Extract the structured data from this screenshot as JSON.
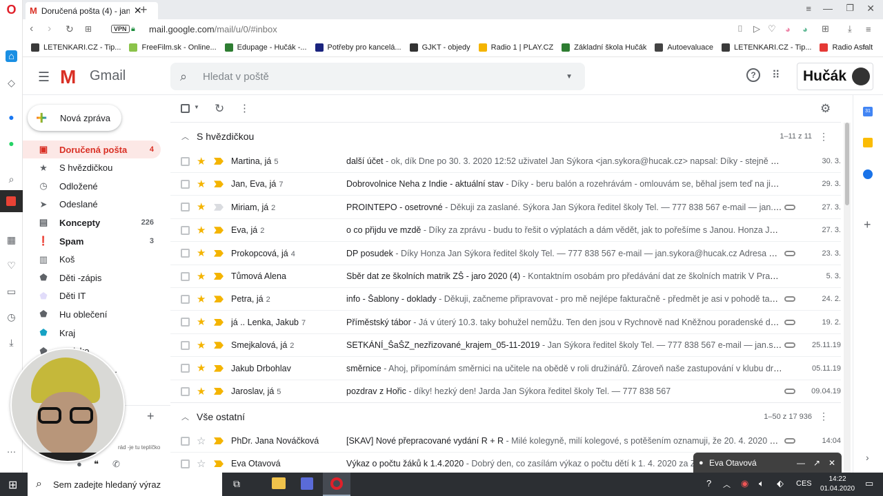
{
  "browser": {
    "tab_title": "Doručená pošta (4) - jan.sy",
    "url_domain": "mail.google.com",
    "url_path": "/mail/u/0/#inbox",
    "vpn_label": "VPN",
    "bookmarks": [
      {
        "label": "LETENKARI.CZ - Tip...",
        "color": "#3a3a3a"
      },
      {
        "label": "FreeFilm.sk - Online...",
        "color": "#8bc34a"
      },
      {
        "label": "Edupage - Hučák -...",
        "color": "#2e7d32"
      },
      {
        "label": "Potřeby pro kancelá...",
        "color": "#1a237e"
      },
      {
        "label": "GJKT - objedy",
        "color": "#333333"
      },
      {
        "label": "Radio 1 | PLAY.CZ",
        "color": "#f4b400"
      },
      {
        "label": "Základní škola Hučák",
        "color": "#2e7d32"
      },
      {
        "label": "Autoevaluace",
        "color": "#444444"
      },
      {
        "label": "LETENKARI.CZ - Tip...",
        "color": "#3a3a3a"
      },
      {
        "label": "Radio Asfalt",
        "color": "#e53935"
      }
    ]
  },
  "gmail": {
    "app_name": "Gmail",
    "search_placeholder": "Hledat v poště",
    "account_logo_text": "Hučák",
    "compose_label": "Nová zpráva",
    "nav": [
      {
        "label": "Doručená pošta",
        "count": "4",
        "icon": "inbox-icon",
        "active": true,
        "bold": true
      },
      {
        "label": "S hvězdičkou",
        "count": "",
        "icon": "star-icon"
      },
      {
        "label": "Odložené",
        "count": "",
        "icon": "clock-icon"
      },
      {
        "label": "Odeslané",
        "count": "",
        "icon": "send-icon"
      },
      {
        "label": "Koncepty",
        "count": "226",
        "icon": "draft-icon",
        "bold": true
      },
      {
        "label": "Spam",
        "count": "3",
        "icon": "spam-icon",
        "bold": true
      },
      {
        "label": "Koš",
        "count": "",
        "icon": "trash-icon"
      },
      {
        "label": "Děti -zápis",
        "count": "",
        "icon": "label-icon",
        "color": "#5f6368"
      },
      {
        "label": "Děti IT",
        "count": "",
        "icon": "label-icon",
        "color": "#e1dcfa"
      },
      {
        "label": "Hu oblečení",
        "count": "",
        "icon": "label-icon",
        "color": "#5f6368"
      },
      {
        "label": "Kraj",
        "count": "",
        "icon": "label-icon",
        "color": "#16a2c4"
      },
      {
        "label": "…alsko",
        "count": "",
        "icon": "label-icon",
        "color": "#5f6368"
      },
      {
        "label": "…chna věci …",
        "count": "",
        "icon": "label-icon",
        "color": "#5f6368"
      }
    ],
    "hangout_snippet": "rád -je tu teplíčko",
    "starred_section": {
      "title": "S hvězdičkou",
      "range": "1–11 z 11",
      "rows": [
        {
          "sender": "Martina, já",
          "count": "5",
          "subject": "další účet",
          "snippet": " - ok, dík Dne po 30. 3. 2020 12:52 uživatel Jan Sýkora <jan.sykora@hucak.cz> napsal: Díky - stejně musí m...",
          "date": "30. 3.",
          "attach": false,
          "imp": true
        },
        {
          "sender": "Jan, Eva, já",
          "count": "7",
          "subject": "Dobrovolnice Neha z Indie - aktuální stav",
          "snippet": " - Díky - beru balón a rozehrávám - omlouvám se, běhal jsem teď na jiných h...",
          "date": "29. 3.",
          "attach": false,
          "imp": true
        },
        {
          "sender": "Miriam, já",
          "count": "2",
          "subject": "PROINTEPO - osetrovné",
          "snippet": " - Děkuji za zaslané. Sýkora Jan Sýkora ředitel školy Tel. — 777 838 567 e-mail — jan.sykora...",
          "date": "27. 3.",
          "attach": true,
          "imp": false
        },
        {
          "sender": "Eva, já",
          "count": "2",
          "subject": "o co přijdu ve mzdě",
          "snippet": " - Díky za zprávu - budu to řešit o výplatách a dám vědět, jak to pořešíme s Janou. Honza Jan Sýk...",
          "date": "27. 3.",
          "attach": false,
          "imp": true
        },
        {
          "sender": "Prokopcová, já",
          "count": "4",
          "subject": "DP posudek",
          "snippet": " - Díky Honza Jan Sýkora ředitel školy Tel. — 777 838 567 e-mail — jan.sykora@hucak.cz Adresa — ZŠ Hu...",
          "date": "23. 3.",
          "attach": true,
          "imp": true
        },
        {
          "sender": "Tůmová Alena",
          "count": "",
          "subject": "Sběr dat ze školních matrik ZŠ - jaro 2020 (4)",
          "snippet": " - Kontaktním osobám pro předávání dat ze školních matrik V Praze 5. ...",
          "date": "5. 3.",
          "attach": false,
          "imp": true
        },
        {
          "sender": "Petra, já",
          "count": "2",
          "subject": "info - Šablony - doklady",
          "snippet": " - Děkuji, začneme připravovat - pro mě nejlépe fakturačně - předmět je asi v pohodě takřka ja...",
          "date": "24. 2.",
          "attach": true,
          "imp": true
        },
        {
          "sender": "já .. Lenka, Jakub",
          "count": "7",
          "subject": "Příměstský tábor",
          "snippet": " - Já v úterý 10.3. taky bohužel nemůžu. Ten den jsou v Rychnově nad Kněžnou poradenské dny s M...",
          "date": "19. 2.",
          "attach": true,
          "imp": true
        },
        {
          "sender": "Smejkalová, já",
          "count": "2",
          "subject": "SETKÁNÍ_ŠaŠZ_nezřizované_krajem_05-11-2019",
          "snippet": " - Jan Sýkora ředitel školy Tel. — 777 838 567 e-mail — jan.sykora@...",
          "date": "25.11.19",
          "attach": true,
          "imp": true
        },
        {
          "sender": "Jakub Drbohlav",
          "count": "",
          "subject": "směrnice",
          "snippet": " - Ahoj, připomínám směrnici na učitele na obědě v roli družinářů. Zároveň naše zastupování v klubu družin...",
          "date": "05.11.19",
          "attach": false,
          "imp": true
        },
        {
          "sender": "Jaroslav, já",
          "count": "5",
          "subject": "pozdrav z Hořic",
          "snippet": " - díky! hezký den! Jarda Jan Sýkora ředitel školy Tel. — 777 838 567",
          "date": "09.04.19",
          "attach": true,
          "imp": true
        }
      ]
    },
    "other_section": {
      "title": "Vše ostatní",
      "range": "1–50 z 17 936",
      "rows": [
        {
          "sender": "PhDr. Jana Nováčková",
          "count": "",
          "subject": "[SKAV] Nové přepracované vydání R + R",
          "snippet": " - Milé kolegyně, milí kolegové, s potěšením oznamuji, že 20. 4. 2020 vyjde n...",
          "date": "14:04",
          "attach": true,
          "imp": true
        },
        {
          "sender": "Eva Otavová",
          "count": "",
          "subject": "Výkaz o počtu žáků k 1.4.2020",
          "snippet": " - Dobrý den, co zasílám výkaz o počtu dětí k 1. 4. 2020 za ZŠ H...",
          "date": "",
          "attach": false,
          "imp": true
        }
      ]
    },
    "chat_popup": {
      "name": "Eva Otavová"
    }
  },
  "taskbar": {
    "search_placeholder": "Sem zadejte hledaný výraz",
    "lang": "CES",
    "time": "14:22",
    "date": "01.04.2020"
  },
  "colors": {
    "gmail_red": "#d93025",
    "star": "#f4b400",
    "important": "#f4b400",
    "inbox_active_bg": "#fce8e6"
  }
}
